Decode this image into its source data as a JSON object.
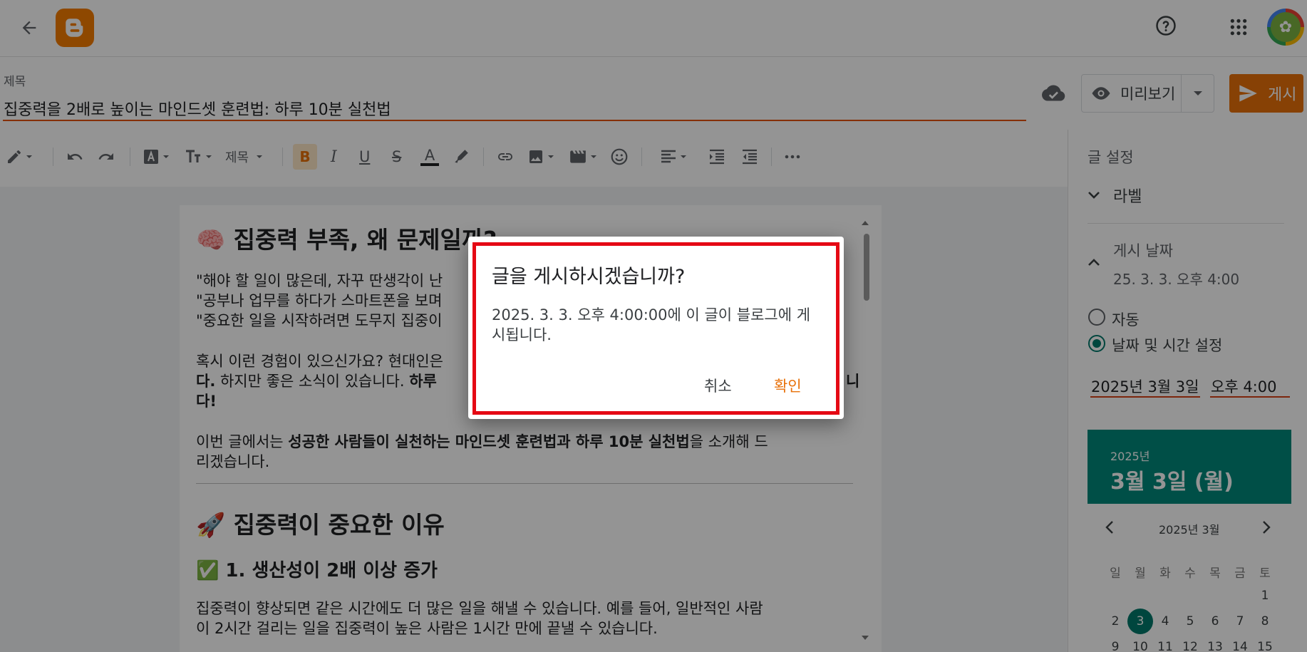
{
  "header": {
    "back_icon": "arrow-left-icon",
    "logo_icon": "blogger-logo-icon",
    "help_icon": "help-circle-icon",
    "apps_icon": "apps-grid-icon",
    "avatar_icon": "flower-avatar-icon"
  },
  "post": {
    "title_label": "제목",
    "title_value": "집중력을 2배로 높이는 마인드셋 훈련법: 하루 10분 실천법",
    "preview_label": "미리보기",
    "publish_label": "게시"
  },
  "toolbar": {
    "heading_label": "제목",
    "bold_label": "B",
    "italic_label": "I",
    "underline_label": "U",
    "strike_label": "S",
    "textcolor_label": "A"
  },
  "content": {
    "h1": "🧠 집중력 부족, 왜 문제일까?",
    "quote1": "\"해야 할 일이 많은데, 자꾸 딴생각이 난",
    "quote2": "\"공부나 업무를 하다가 스마트폰을 보며",
    "quote3": "\"중요한 일을 시작하려면 도무지 집중이",
    "para1a": "혹시 이런 경험이 있으신가요? 현대인은",
    "para1b": "다.",
    "para1c": " 하지만 좋은 소식이 있습니다. ",
    "para1d": "하루",
    "para1e": "니",
    "para1f": "다!",
    "para2a": "이번 글에서는 ",
    "para2b": "성공한 사람들이 실천하는 마인드셋 훈련법과 하루 10분 실천법",
    "para2c": "을 소개해 드",
    "para2d": "리겠습니다.",
    "h2": "🚀 집중력이 중요한 이유",
    "h3": "✅ 1. 생산성이 2배 이상 증가",
    "para3a": "집중력이 향상되면 같은 시간에도 더 많은 일을 해낼 수 있습니다. 예를 들어, 일반적인 사람",
    "para3b": "이 2시간 걸리는 일을 집중력이 높은 사람은 1시간 만에 끝낼 수 있습니다."
  },
  "sidebar": {
    "settings_label": "글 설정",
    "labels_section": "라벨",
    "publish_date_section": "게시 날짜",
    "publish_date_value": "25. 3. 3. 오후 4:00",
    "option_auto": "자동",
    "option_custom": "날짜 및 시간 설정",
    "date_field": "2025년 3월 3일",
    "time_field": "오후 4:00",
    "calendar": {
      "year": "2025년",
      "selected_label": "3월 3일 (월)",
      "month_label": "2025년 3월",
      "weekdays": [
        "일",
        "월",
        "화",
        "수",
        "목",
        "금",
        "토"
      ],
      "row1": [
        "",
        "",
        "",
        "",
        "",
        "",
        "1"
      ],
      "row2": [
        "2",
        "3",
        "4",
        "5",
        "6",
        "7",
        "8"
      ],
      "row3": [
        "9",
        "10",
        "11",
        "12",
        "13",
        "14",
        "15"
      ],
      "selected_day": "3"
    }
  },
  "dialog": {
    "title": "글을 게시하시겠습니까?",
    "body": "2025. 3. 3. 오후 4:00:00에 이 글이 블로그에 게시됩니다.",
    "cancel_label": "취소",
    "confirm_label": "확인"
  },
  "colors": {
    "accent": "#e8710a",
    "teal": "#00897b",
    "highlight_outline": "#e50914"
  }
}
